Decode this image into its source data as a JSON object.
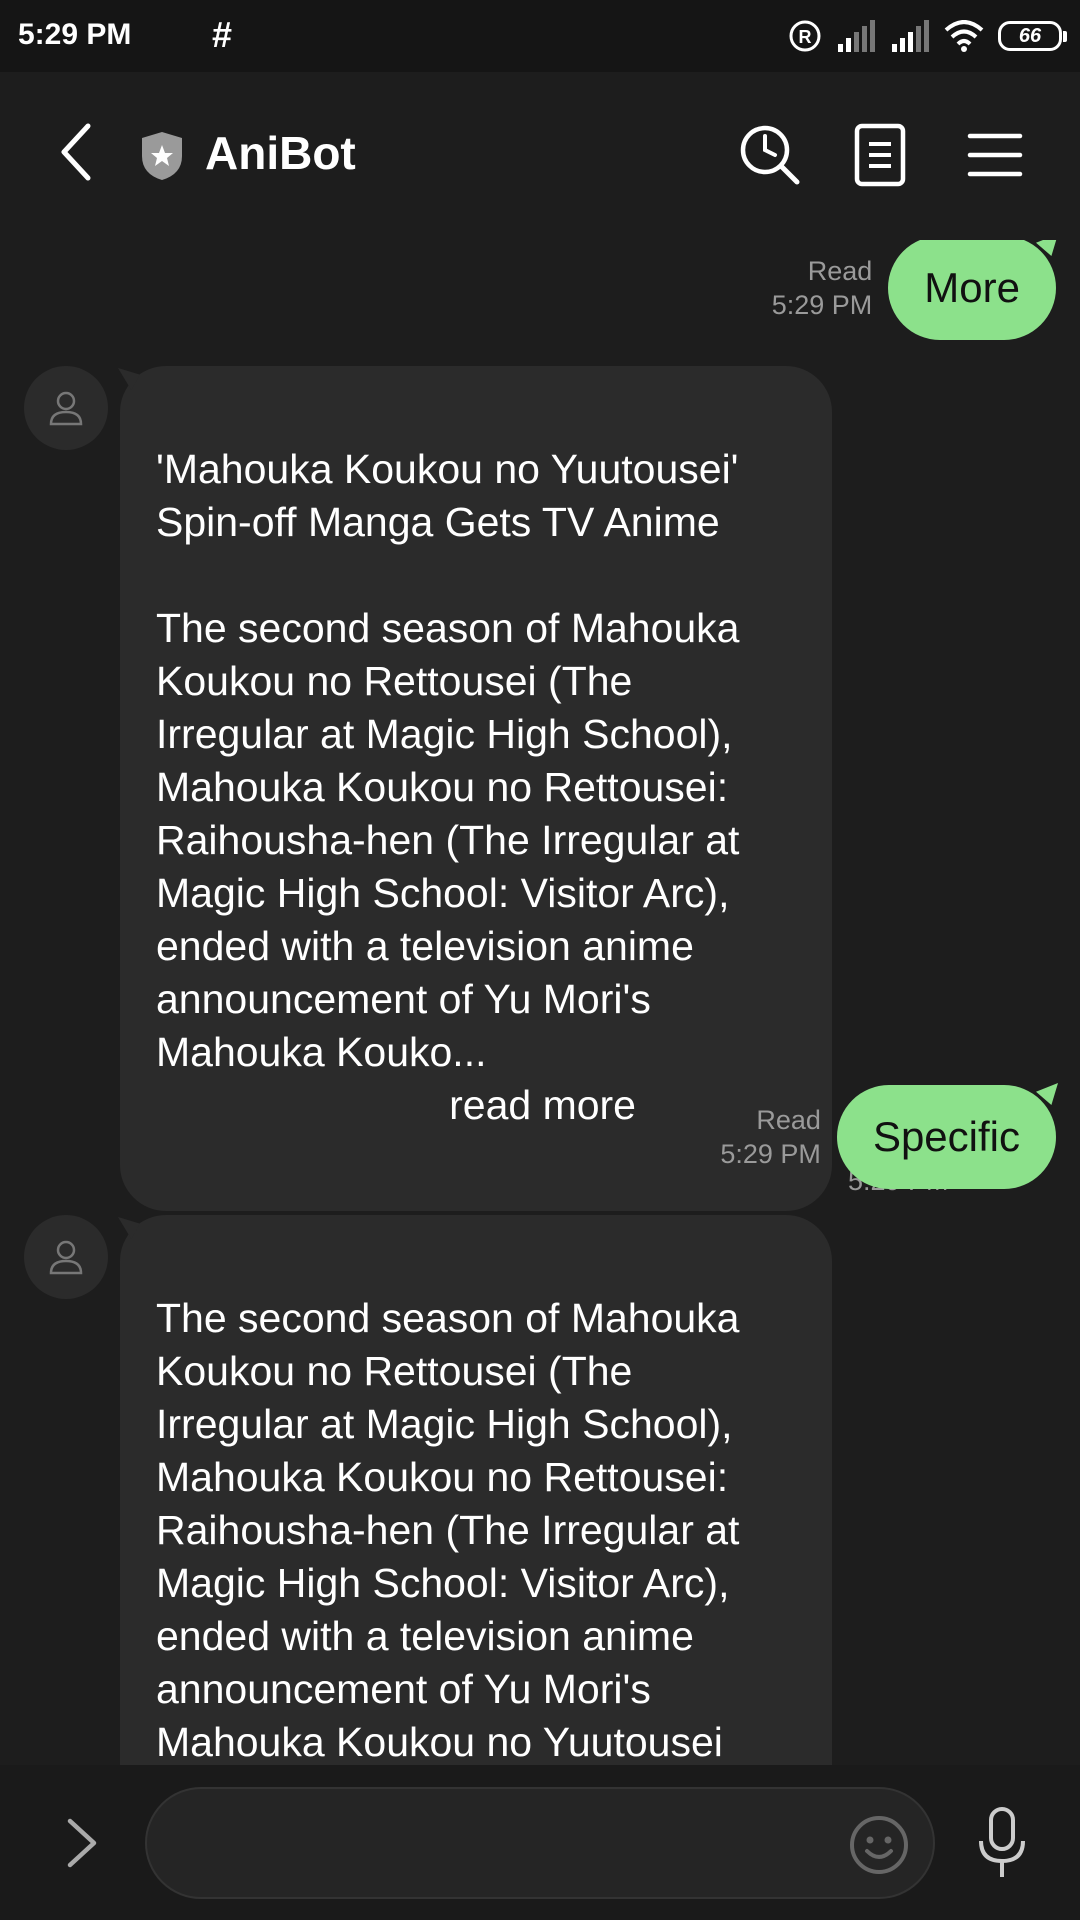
{
  "status_bar": {
    "time": "5:29 PM",
    "hash": "#",
    "battery": "66"
  },
  "header": {
    "title": "AniBot"
  },
  "messages": [
    {
      "type": "out",
      "read": "Read",
      "time": "5:29 PM",
      "text": "More"
    },
    {
      "type": "in",
      "title": "'Mahouka Koukou no Yuutousei'\nSpin-off Manga Gets TV Anime",
      "body": "The second season of Mahouka Koukou no Rettousei (The Irregular at Magic High School), Mahouka Koukou no Rettousei: Raihousha-hen (The Irregular at Magic High School: Visitor Arc), ended with a television anime announcement of Yu Mori's Mahouka Kouko...",
      "link": "read more",
      "time": "5:29 PM"
    },
    {
      "type": "out",
      "read": "Read",
      "time": "5:29 PM",
      "text": "Specific"
    },
    {
      "type": "in",
      "body": "The second season of Mahouka Koukou no Rettousei (The Irregular at Magic High School), Mahouka Koukou no Rettousei: Raihousha-hen (The Irregular at Magic High School: Visitor Arc), ended with a television anime announcement of Yu Mori's Mahouka Koukou no Yuutousei (The Honor Student at Magic High School) spin-off manga on Sunday."
    }
  ],
  "input": {
    "placeholder": ""
  },
  "colors": {
    "background": "#1d1d1d",
    "outgoing_bubble": "#8ce18b",
    "incoming_bubble": "#2b2b2b",
    "meta_text": "#9a9a9a"
  },
  "icons": [
    "back-arrow-icon",
    "shield-icon",
    "search-icon",
    "notes-icon",
    "menu-icon",
    "user-icon",
    "chevron-right-icon",
    "emoji-icon",
    "mic-icon",
    "signal-icon",
    "wifi-icon",
    "registered-icon",
    "battery-icon"
  ]
}
